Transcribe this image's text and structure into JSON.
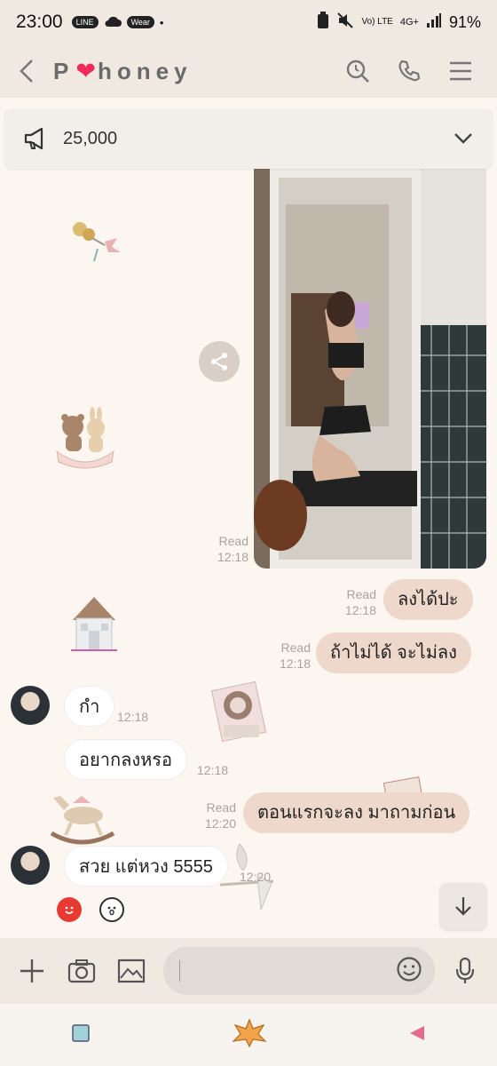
{
  "status_bar": {
    "time": "23:00",
    "line_pill": "LINE",
    "wear_pill": "Wear",
    "dot": "•",
    "network_volte": "Vo) LTE",
    "network_4g": "4G+",
    "battery": "91%"
  },
  "header": {
    "title_before": "P",
    "title_after": "honey"
  },
  "announcement": {
    "text": "25,000"
  },
  "photo_meta": {
    "read": "Read",
    "time": "12:18"
  },
  "messages": [
    {
      "side": "out",
      "text": "ลงได้ปะ",
      "read": "Read",
      "time": "12:18"
    },
    {
      "side": "out",
      "text": "ถ้าไม่ได้ จะไม่ลง",
      "read": "Read",
      "time": "12:18"
    },
    {
      "side": "in",
      "text": "กำ",
      "time": "12:18"
    },
    {
      "side": "in",
      "text": "อยากลงหรอ",
      "time": "12:18"
    },
    {
      "side": "out",
      "text": "ตอนแรกจะลง มาถามก่อน",
      "read": "Read",
      "time": "12:20"
    },
    {
      "side": "in",
      "text": "สวย แต่หวง 5555",
      "time": "12:20"
    }
  ],
  "composer": {
    "placeholder": ""
  },
  "colors": {
    "background": "#fbf6f0",
    "header": "#efe9e2",
    "outgoing_bubble": "#eed8cb",
    "incoming_bubble": "#ffffff",
    "heart": "#f02a5a"
  }
}
